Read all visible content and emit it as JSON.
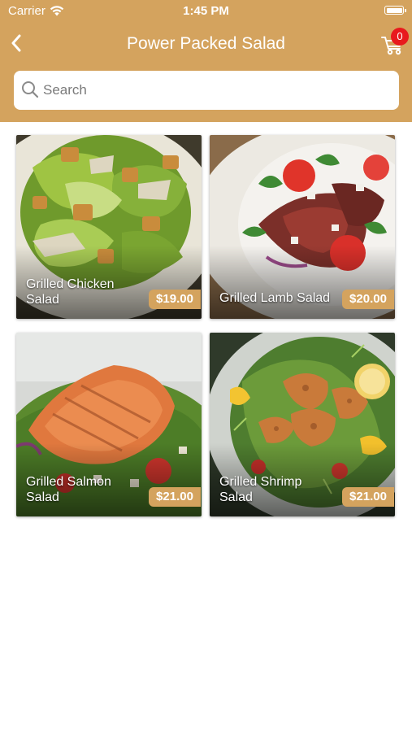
{
  "status_bar": {
    "carrier": "Carrier",
    "time": "1:45 PM",
    "wifi_icon": "wifi-icon",
    "battery_icon": "battery-icon"
  },
  "header": {
    "title": "Power Packed Salad",
    "back_icon": "chevron-left-icon",
    "cart_icon": "shopping-cart-icon",
    "cart_count": "0"
  },
  "search": {
    "placeholder": "Search",
    "value": "",
    "icon": "search-icon"
  },
  "products": [
    {
      "name": "Grilled Chicken Salad",
      "price": "$19.00"
    },
    {
      "name": "Grilled Lamb Salad",
      "price": "$20.00"
    },
    {
      "name": "Grilled Salmon Salad",
      "price": "$21.00"
    },
    {
      "name": "Grilled Shrimp Salad",
      "price": "$21.00"
    }
  ],
  "colors": {
    "accent": "#d4a35e",
    "badge": "#e8191d",
    "background": "#ffffff"
  }
}
